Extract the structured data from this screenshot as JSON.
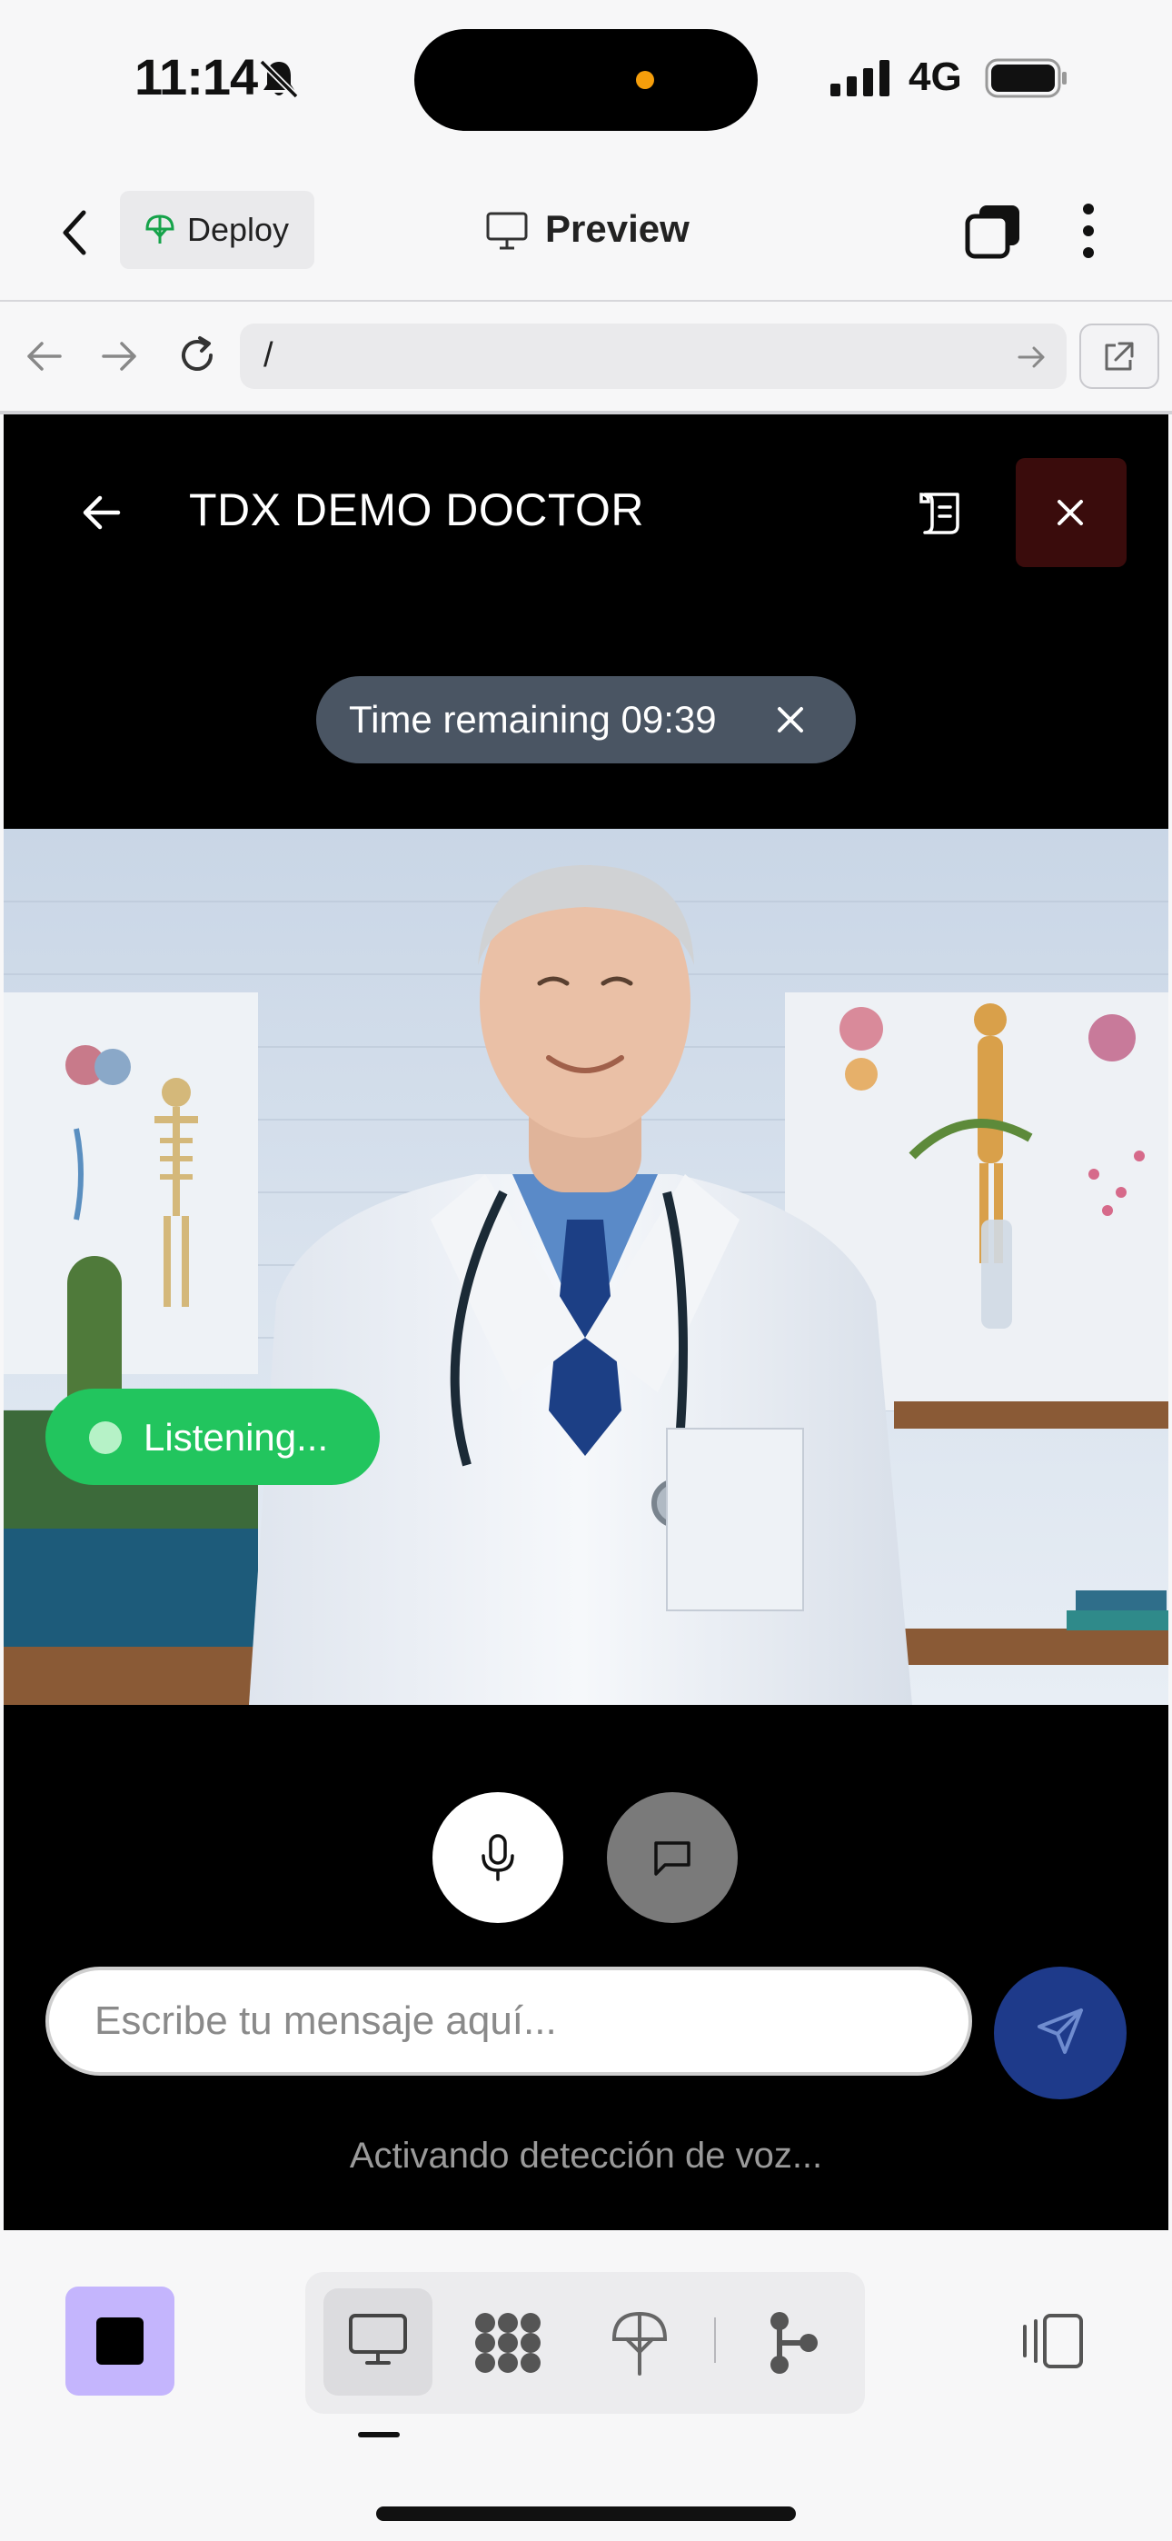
{
  "status_bar": {
    "time": "11:14",
    "network": "4G"
  },
  "app_header": {
    "deploy_label": "Deploy",
    "preview_label": "Preview"
  },
  "url_bar": {
    "path": "/"
  },
  "session": {
    "title": "TDX DEMO DOCTOR",
    "timer_label": "Time remaining 09:39",
    "listening_label": "Listening...",
    "message_placeholder": "Escribe tu mensaje aquí...",
    "status_text": "Activando detección de voz..."
  },
  "colors": {
    "accent_send": "#1e3a8a",
    "listening": "#22c55e",
    "close_bg": "#3a0c0c",
    "stop_bg": "#c4b5fd"
  },
  "icons": [
    "bell-muted-icon",
    "signal-icon",
    "battery-icon",
    "chevron-left-icon",
    "deploy-icon",
    "monitor-icon",
    "tabs-icon",
    "more-icon",
    "arrow-left-icon",
    "arrow-right-icon",
    "reload-icon",
    "external-link-icon",
    "notes-icon",
    "close-icon",
    "mic-icon",
    "chat-icon",
    "send-icon",
    "stop-icon",
    "grid-icon",
    "upload-icon",
    "share-icon",
    "device-rotate-icon"
  ]
}
